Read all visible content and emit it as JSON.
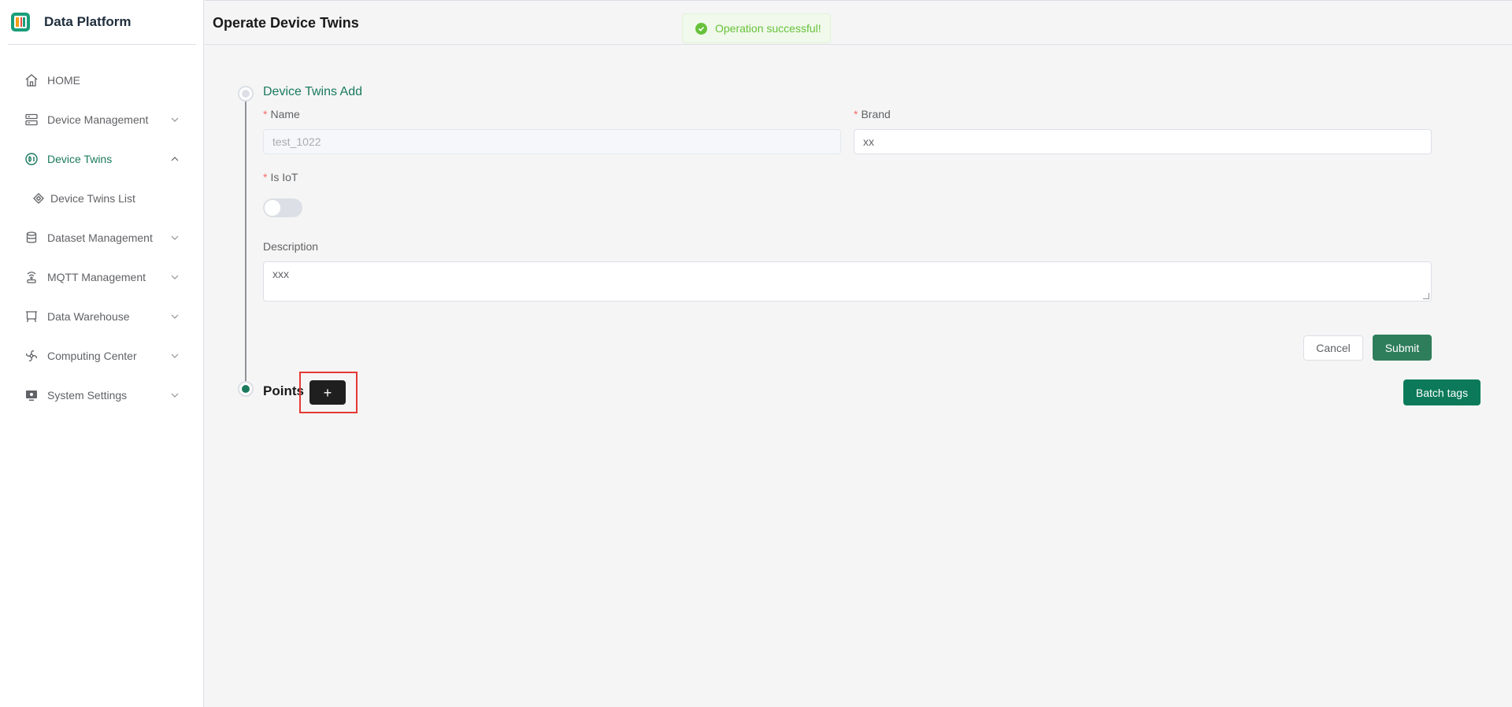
{
  "app": {
    "title": "Data Platform"
  },
  "sidebar": {
    "items": [
      {
        "label": "HOME",
        "icon": "home-icon"
      },
      {
        "label": "Device Management",
        "icon": "server-icon"
      },
      {
        "label": "Device Twins",
        "icon": "twins-icon"
      },
      {
        "label": "Device Twins List",
        "icon": "diamond-icon"
      },
      {
        "label": "Dataset Management",
        "icon": "database-icon"
      },
      {
        "label": "MQTT Management",
        "icon": "broadcast-icon"
      },
      {
        "label": "Data Warehouse",
        "icon": "board-icon"
      },
      {
        "label": "Computing Center",
        "icon": "fan-icon"
      },
      {
        "label": "System Settings",
        "icon": "monitor-icon"
      }
    ]
  },
  "header": {
    "title": "Operate Device Twins"
  },
  "toast": {
    "message": "Operation successful!"
  },
  "form": {
    "step_title": "Device Twins Add",
    "name_label": "Name",
    "name_value": "test_1022",
    "brand_label": "Brand",
    "brand_value": "xx",
    "iot_label": "Is IoT",
    "iot_on": false,
    "description_label": "Description",
    "description_value": "xxx",
    "required_mark": "*",
    "cancel_label": "Cancel",
    "submit_label": "Submit"
  },
  "points": {
    "title": "Points",
    "add_label": "+",
    "batch_label": "Batch tags"
  },
  "colors": {
    "accent": "#1a7a5e",
    "success": "#67c23a",
    "required": "#f56c6c",
    "highlight": "#e53935"
  }
}
